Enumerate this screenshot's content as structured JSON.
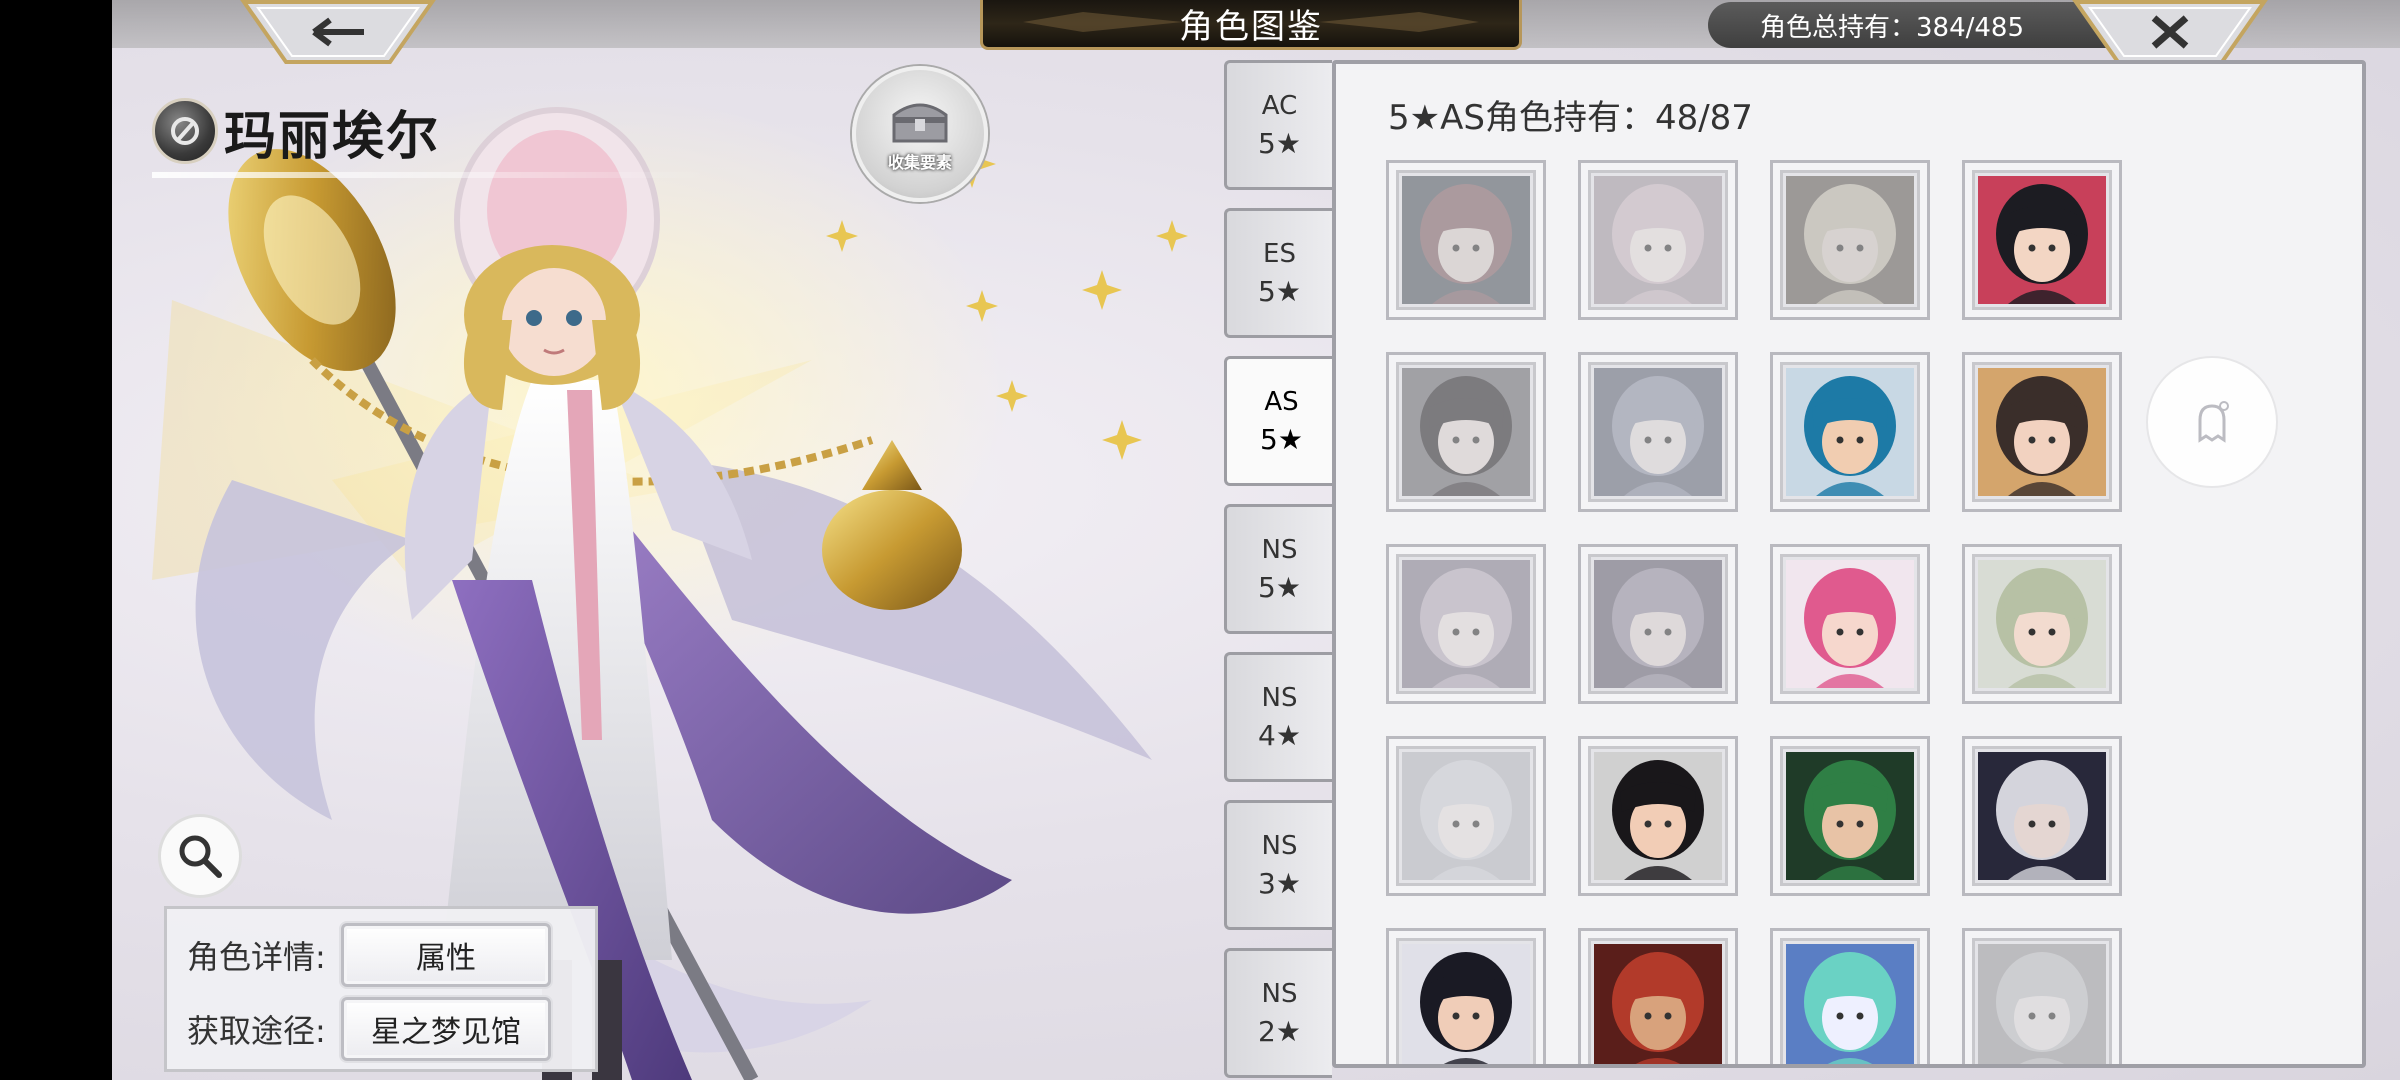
{
  "header": {
    "title": "角色图鉴",
    "total_label": "角色总持有：384/485",
    "back_icon": "arrow-left-icon",
    "close_icon": "close-icon"
  },
  "character": {
    "name": "玛丽埃尔",
    "collect_label": "收集要素"
  },
  "info": {
    "detail_label": "角色详情:",
    "detail_value": "属性",
    "source_label": "获取途径:",
    "source_value": "星之梦见馆"
  },
  "tabs": [
    {
      "code": "AC",
      "rank": "5★",
      "active": false
    },
    {
      "code": "ES",
      "rank": "5★",
      "active": false
    },
    {
      "code": "AS",
      "rank": "5★",
      "active": true
    },
    {
      "code": "NS",
      "rank": "5★",
      "active": false
    },
    {
      "code": "NS",
      "rank": "4★",
      "active": false
    },
    {
      "code": "NS",
      "rank": "3★",
      "active": false
    },
    {
      "code": "NS",
      "rank": "2★",
      "active": false
    }
  ],
  "panel": {
    "count_title": "5★AS角色持有：48/87"
  },
  "portraits": [
    {
      "hair": "#c9475a",
      "skin": "#e9c6b4",
      "bg": "#3a5a7a",
      "owned": false
    },
    {
      "hair": "#e9a9c9",
      "skin": "#f3d6cf",
      "bg": "#b58fb0",
      "owned": false
    },
    {
      "hair": "#c9b074",
      "skin": "#e2c0a0",
      "bg": "#6d5a3e",
      "owned": false
    },
    {
      "hair": "#1c1c22",
      "skin": "#f3d6c4",
      "bg": "#c8405a",
      "owned": true
    },
    {
      "hair": "#2e2230",
      "skin": "#f0cdbd",
      "bg": "#6a6a7a",
      "owned": false
    },
    {
      "hair": "#7b8fd6",
      "skin": "#e9d2cc",
      "bg": "#5565a5",
      "owned": false
    },
    {
      "hair": "#1d7aa6",
      "skin": "#f1cdb1",
      "bg": "#c8d8e4",
      "owned": true
    },
    {
      "hair": "#3a2e2a",
      "skin": "#f2d2c0",
      "bg": "#d4a56c",
      "owned": true
    },
    {
      "hair": "#c7a1d8",
      "skin": "#f2d7d2",
      "bg": "#8c78b0",
      "owned": false
    },
    {
      "hair": "#9a84c8",
      "skin": "#ecccc4",
      "bg": "#6d5a96",
      "owned": false
    },
    {
      "hair": "#e05a8e",
      "skin": "#f6d7cd",
      "bg": "#f1e6ee",
      "owned": true
    },
    {
      "hair": "#b7c1a5",
      "skin": "#f2dbcf",
      "bg": "#d8dcd4",
      "owned": true
    },
    {
      "hair": "#c6cde4",
      "skin": "#efdcd7",
      "bg": "#aeb6cf",
      "owned": false
    },
    {
      "hair": "#19171a",
      "skin": "#f2cdb6",
      "bg": "#d0d0d0",
      "owned": true
    },
    {
      "hair": "#2f7f45",
      "skin": "#e8c3a6",
      "bg": "#1f3b28",
      "owned": true
    },
    {
      "hair": "#d4d4dc",
      "skin": "#e4d6d2",
      "bg": "#28283a",
      "owned": true
    },
    {
      "hair": "#1a1a24",
      "skin": "#f0cdb8",
      "bg": "#e0e0e8",
      "owned": true
    },
    {
      "hair": "#b23a2a",
      "skin": "#d8a27c",
      "bg": "#5a1e1a",
      "owned": true
    },
    {
      "hair": "#6ad2c4",
      "skin": "#eef0ff",
      "bg": "#5a7ec4",
      "owned": true
    },
    {
      "hair": "#b9bbc6",
      "skin": "#e3d8d6",
      "bg": "#9a9aa4",
      "owned": false
    }
  ]
}
